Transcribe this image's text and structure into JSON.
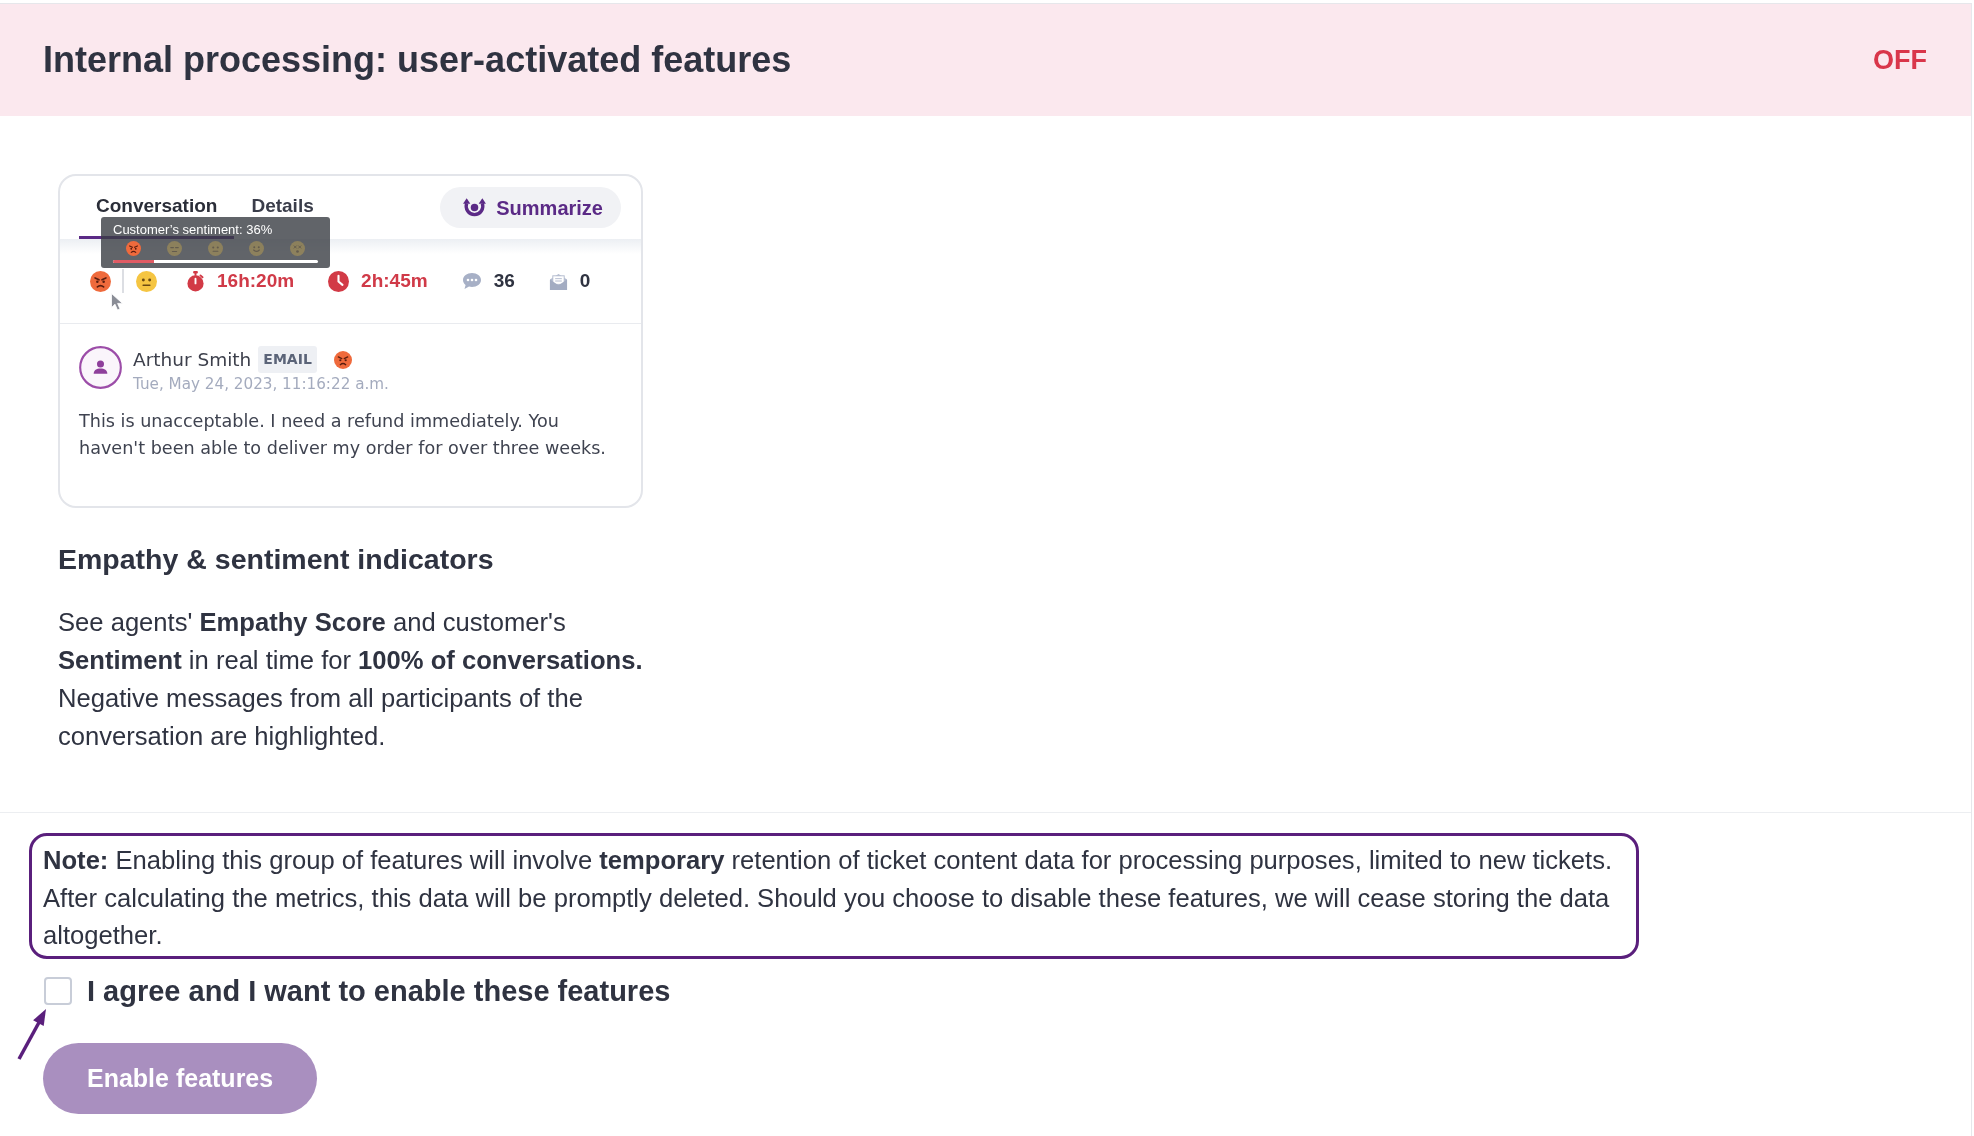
{
  "header": {
    "title": "Internal processing: user-activated features",
    "status": "OFF"
  },
  "feature": {
    "preview": {
      "tabs": [
        {
          "label": "Conversation",
          "selected": true
        },
        {
          "label": "Details",
          "selected": false
        }
      ],
      "summarize_button": "Summarize",
      "tooltip": {
        "text": "Customer’s sentiment: 36%",
        "faces": [
          {
            "kind": "angry",
            "selected": true
          },
          {
            "kind": "expressionless",
            "selected": false
          },
          {
            "kind": "neutral",
            "selected": false
          },
          {
            "kind": "smile",
            "selected": false
          },
          {
            "kind": "dizzy",
            "selected": false
          }
        ],
        "level": 0.2
      },
      "stats": [
        {
          "kind": "stopwatch",
          "value": "16h:20m",
          "alert": true
        },
        {
          "kind": "clock",
          "value": "2h:45m",
          "alert": true
        },
        {
          "kind": "chat",
          "value": "36",
          "alert": false
        },
        {
          "kind": "envelope",
          "value": "0",
          "alert": false
        }
      ],
      "message": {
        "author": "Arthur Smith",
        "channel": "EMAIL",
        "timestamp": "Tue, May 24, 2023, 11:16:22 a.m.",
        "text": "This is unacceptable. I need a refund immediately. You haven't been able to deliver my order for over three weeks."
      }
    },
    "title": "Empathy & sentiment indicators",
    "description": "See agents' **Empathy Score** and customer's **Sentiment** in real time for **100% of conversations.** Negative messages from all participants of the conversation are highlighted."
  },
  "note": "**Note:** Enabling this group of features will involve **temporary** retention of ticket content data for processing purposes, limited to new tickets. After calculating the metrics, this data will be promptly deleted. Should you choose to disable these features, we will cease storing the data altogether.",
  "consent": {
    "label": "I agree and I want to enable these features",
    "checked": false
  },
  "enable_button": {
    "label": "Enable features",
    "disabled": true
  }
}
